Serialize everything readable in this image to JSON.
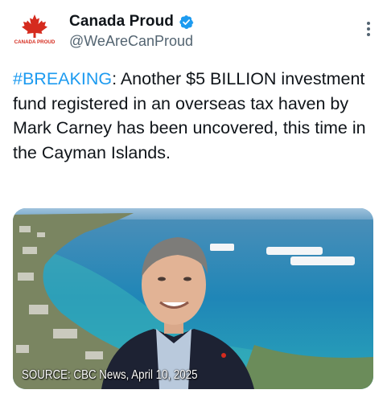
{
  "author": {
    "display_name": "Canada Proud",
    "handle": "@WeAreCanProud",
    "avatar_text": "CANADA PROUD",
    "verified_icon": "verified-badge-icon",
    "colors": {
      "logo_red": "#d52b1e",
      "verified_blue": "#1d9bf0"
    }
  },
  "tweet": {
    "hashtag": "#BREAKING",
    "text": ": Another $5 BILLION investment fund registered in an overseas tax haven by Mark Carney has been uncovered, this time in the Cayman Islands."
  },
  "media": {
    "caption": "SOURCE: CBC News, April 10, 2025"
  },
  "menu": {
    "icon": "more-vertical-icon"
  }
}
